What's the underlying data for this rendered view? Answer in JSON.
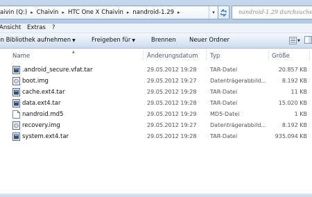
{
  "address": {
    "segments": [
      "aivin (Q:)",
      "Chaivin",
      "HTC One X Chaivin",
      "nandroid-1.29"
    ],
    "search_placeholder": "nandroid-1.29 durchsuchen"
  },
  "menu": {
    "items": [
      "Ansicht",
      "Extras",
      "?"
    ]
  },
  "toolbar": {
    "library_label": "In Bibliothek aufnehmen",
    "share_label": "Freigeben für",
    "burn_label": "Brennen",
    "new_folder_label": "Neuer Ordner"
  },
  "columns": {
    "name": "Name",
    "date": "Änderungsdatum",
    "type": "Typ",
    "size": "Größe"
  },
  "files": [
    {
      "name": ".android_secure.vfat.tar",
      "date": "29.05.2012 19:28",
      "type": "TAR-Datei",
      "size": "20.857 KB",
      "icon": "tar-file-icon"
    },
    {
      "name": "boot.img",
      "date": "29.05.2012 19:27",
      "type": "Datenträgerabbild...",
      "size": "8.192 KB",
      "icon": "disk-image-icon"
    },
    {
      "name": "cache.ext4.tar",
      "date": "29.05.2012 19:28",
      "type": "TAR-Datei",
      "size": "11 KB",
      "icon": "tar-file-icon"
    },
    {
      "name": "data.ext4.tar",
      "date": "29.05.2012 19:28",
      "type": "TAR-Datei",
      "size": "15.020 KB",
      "icon": "tar-file-icon"
    },
    {
      "name": "nandroid.md5",
      "date": "29.05.2012 19:29",
      "type": "MD5-Datei",
      "size": "1 KB",
      "icon": "blank-file-icon"
    },
    {
      "name": "recovery.img",
      "date": "29.05.2012 19:27",
      "type": "Datenträgerabbild...",
      "size": "8.192 KB",
      "icon": "disk-image-icon"
    },
    {
      "name": "system.ext4.tar",
      "date": "29.05.2012 19:28",
      "type": "TAR-Datei",
      "size": "935.094 KB",
      "icon": "tar-file-icon"
    }
  ]
}
